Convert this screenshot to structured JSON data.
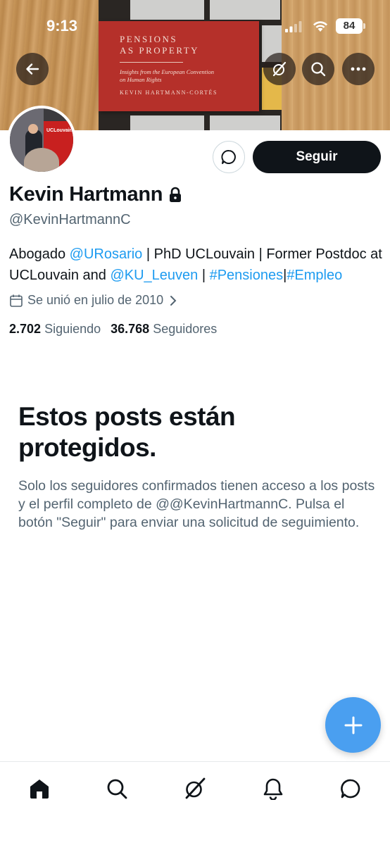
{
  "status_bar": {
    "time": "9:13",
    "battery": "84"
  },
  "banner": {
    "book_title_line1": "PENSIONS",
    "book_title_line2": "AS PROPERTY",
    "book_subtitle_line1": "Insights from the European Convention",
    "book_subtitle_line2": "on Human Rights",
    "book_author": "KEVIN HARTMANN-CORTÉS"
  },
  "header_buttons": [
    "back-icon",
    "grok-icon",
    "search-icon",
    "more-icon"
  ],
  "avatar": {
    "label": "UCLouvain"
  },
  "profile": {
    "name": "Kevin Hartmann",
    "handle": "@KevinHartmannC",
    "follow_label": "Seguir",
    "bio": {
      "t1": "Abogado ",
      "m1": "@URosario",
      "t2": " | PhD UCLouvain | Former Postdoc at UCLouvain and ",
      "m2": "@KU_Leuven",
      "t3": " | ",
      "h1": "#Pensiones",
      "t4": "|",
      "h2": "#Empleo"
    },
    "joined": "Se unió en julio de 2010",
    "following_count": "2.702",
    "following_label": "Siguiendo",
    "followers_count": "36.768",
    "followers_label": "Seguidores"
  },
  "protected": {
    "title": "Estos posts están protegidos.",
    "body": "Solo los seguidores confirmados tienen acceso a los posts y el perfil completo de @@KevinHartmannC. Pulsa el botón \"Seguir\" para enviar una solicitud de seguimiento."
  },
  "tabbar": [
    "home-icon",
    "search-icon",
    "grok-icon",
    "bell-icon",
    "messages-icon"
  ],
  "colors": {
    "accent": "#1d9bf0",
    "fab": "#4a9ff0",
    "text": "#0f1419",
    "muted": "#536471"
  }
}
